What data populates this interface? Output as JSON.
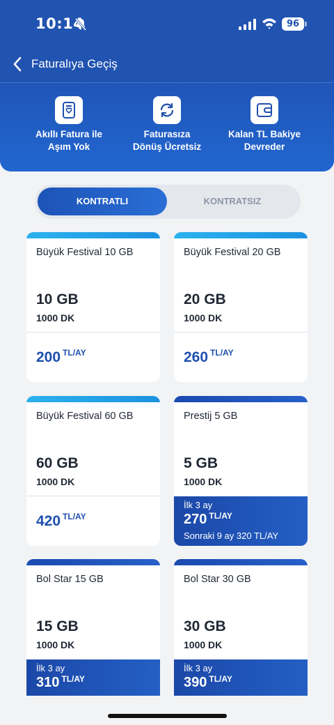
{
  "status": {
    "time": "10:14",
    "battery": "96"
  },
  "nav": {
    "title": "Faturalıya Geçiş"
  },
  "features": [
    {
      "icon": "smart-bill-icon",
      "label_line1": "Akıllı Fatura ile",
      "label_line2": "Aşım Yok"
    },
    {
      "icon": "refresh-icon",
      "label_line1": "Faturasıza",
      "label_line2": "Dönüş Ücretsiz"
    },
    {
      "icon": "wallet-icon",
      "label_line1": "Kalan TL Bakiye",
      "label_line2": "Devreder"
    }
  ],
  "tabs": {
    "active": "KONTRATLI",
    "inactive": "KONTRATSIZ"
  },
  "price_unit": "TL/AY",
  "plans": [
    {
      "name": "Büyük Festival 10 GB",
      "data": "10 GB",
      "minutes": "1000 DK",
      "price": "200"
    },
    {
      "name": "Büyük Festival 20 GB",
      "data": "20 GB",
      "minutes": "1000 DK",
      "price": "260"
    },
    {
      "name": "Büyük Festival 60 GB",
      "data": "60 GB",
      "minutes": "1000 DK",
      "price": "420"
    },
    {
      "name": "Prestij 5 GB",
      "data": "5 GB",
      "minutes": "1000 DK",
      "promo_label": "İlk 3 ay",
      "price": "270",
      "followup": "Sonraki 9 ay 320 TL/AY"
    },
    {
      "name": "Bol Star 15 GB",
      "data": "15 GB",
      "minutes": "1000 DK",
      "promo_label": "İlk 3 ay",
      "price": "310"
    },
    {
      "name": "Bol Star 30 GB",
      "data": "30 GB",
      "minutes": "1000 DK",
      "promo_label": "İlk 3 ay",
      "price": "390"
    }
  ],
  "colors": {
    "brand": "#2153b1",
    "price": "#1f4fae",
    "accent_light": "#2cb2ee"
  }
}
